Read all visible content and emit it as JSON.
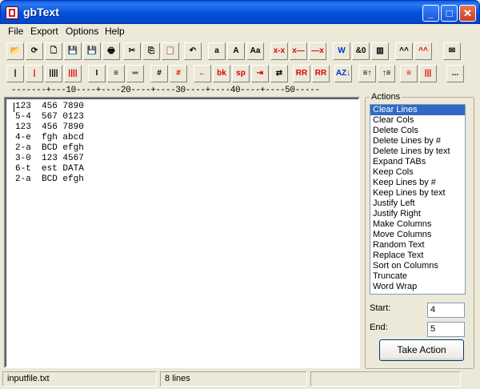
{
  "window": {
    "title": "gbText",
    "buttons": {
      "minimize": "_",
      "maximize": "□",
      "close": "✕"
    }
  },
  "menu": [
    "File",
    "Export",
    "Options",
    "Help"
  ],
  "toolbar1": [
    {
      "icon": "open-folder-icon",
      "glyph": "📂"
    },
    {
      "icon": "refresh-icon",
      "glyph": "⟳"
    },
    {
      "icon": "new-file-icon",
      "glyph": "🗋"
    },
    {
      "icon": "save-icon",
      "glyph": "💾"
    },
    {
      "icon": "save-as-icon",
      "glyph": "💾"
    },
    {
      "icon": "print-icon",
      "glyph": "🖶"
    },
    {
      "icon": "cut-icon",
      "glyph": "✂"
    },
    {
      "icon": "copy-icon",
      "glyph": "⎘"
    },
    {
      "icon": "paste-icon",
      "glyph": "📋"
    },
    {
      "icon": "undo-icon",
      "glyph": "↶"
    },
    {
      "label": "a"
    },
    {
      "label": "A"
    },
    {
      "label": "Aa"
    },
    {
      "label": "x-x",
      "red": true
    },
    {
      "label": "x—",
      "red": true
    },
    {
      "label": "—x",
      "red": true
    },
    {
      "label": "W",
      "blue": true
    },
    {
      "label": "&0"
    },
    {
      "icon": "columns-icon",
      "glyph": "▥"
    },
    {
      "label": "^^"
    },
    {
      "label": "^^",
      "red": true
    },
    {
      "icon": "mail-icon",
      "glyph": "✉"
    }
  ],
  "toolbar2": [
    {
      "label": "|"
    },
    {
      "label": "|",
      "red": true
    },
    {
      "label": "||||"
    },
    {
      "label": "||||",
      "red": true
    },
    {
      "label": "I"
    },
    {
      "label": "≡"
    },
    {
      "label": "═"
    },
    {
      "label": "#"
    },
    {
      "label": "#",
      "red": true
    },
    {
      "label": "←",
      "red": true
    },
    {
      "label": "bk",
      "red": true
    },
    {
      "label": "sp",
      "red": true
    },
    {
      "label": "⇥",
      "red": true
    },
    {
      "label": "⇄"
    },
    {
      "label": "RR",
      "red": true
    },
    {
      "label": "RR",
      "red": true
    },
    {
      "label": "AZ↓",
      "blue": true
    },
    {
      "label": "≡↑"
    },
    {
      "label": "↑≡"
    },
    {
      "label": "≡",
      "red": true
    },
    {
      "label": "|||",
      "red": true
    },
    {
      "label": "..."
    }
  ],
  "ruler": "-------+---10----+----20----+----30----+----40----+----50-----",
  "editor": {
    "lines": [
      "123  456 7890",
      "5-4  567 0123",
      "123  456 7890",
      "4-e  fgh abcd",
      "2-a  BCD efgh",
      "3-0  123 4567",
      "6-t  est DATA",
      "2-a  BCD efgh"
    ]
  },
  "actions": {
    "label": "Actions",
    "items": [
      "Clear Lines",
      "Clear Cols",
      "Delete Cols",
      "Delete Lines by #",
      "Delete Lines by text",
      "Expand TABs",
      "Keep Cols",
      "Keep Lines by #",
      "Keep Lines by text",
      "Justify Left",
      "Justify Right",
      "Make Columns",
      "Move Columns",
      "Random Text",
      "Replace Text",
      "Sort on Columns",
      "Truncate",
      "Word Wrap"
    ],
    "selected": 0,
    "start_label": "Start:",
    "start_value": "4",
    "end_label": "End:",
    "end_value": "5",
    "button": "Take Action"
  },
  "status": {
    "file": "inputfile.txt",
    "lines": "8 lines"
  },
  "colors": {
    "selection": "#316ac5",
    "titlebar": "#0a5ce8",
    "accent_red": "#d00000"
  }
}
